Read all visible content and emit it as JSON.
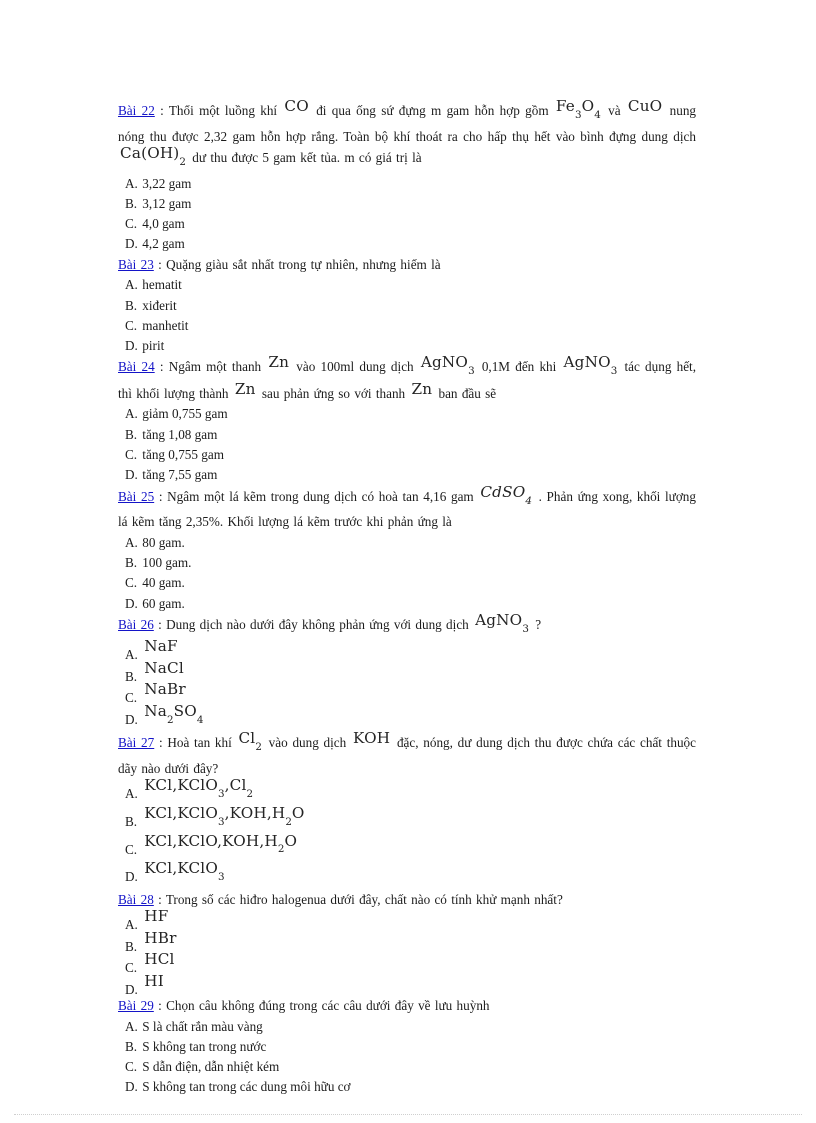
{
  "document": {
    "language": "vi",
    "subject": "Hoa hoc - trac nghiem",
    "accent_color": "#1414c8",
    "text_color": "#1c1c1c"
  },
  "questions": [
    {
      "label": "Bài 22",
      "separator": ":",
      "stem_parts": [
        {
          "type": "text",
          "value": "Thổi một luồng khí "
        },
        {
          "type": "chem",
          "value": "CO"
        },
        {
          "type": "text",
          "value": " đi qua ống sứ đựng m gam hỗn hợp gồm "
        },
        {
          "type": "chem",
          "value": "Fe3O4"
        },
        {
          "type": "text",
          "value": " và "
        },
        {
          "type": "chem",
          "value": "CuO"
        },
        {
          "type": "text",
          "value": " nung nóng thu được 2,32 gam hỗn hợp rắng. Toàn bộ khí thoát ra cho hấp thụ hết vào bình đựng dung dịch "
        },
        {
          "type": "chem",
          "value": "Ca(OH)2"
        },
        {
          "type": "text",
          "value": " dư thu được 5 gam kết tủa. m có giá trị là"
        }
      ],
      "options": [
        {
          "letter": "A.",
          "text": "3,22 gam"
        },
        {
          "letter": "B.",
          "text": "3,12 gam"
        },
        {
          "letter": "C.",
          "text": "4,0 gam"
        },
        {
          "letter": "D.",
          "text": "4,2 gam"
        }
      ]
    },
    {
      "label": "Bài 23",
      "separator": ":",
      "stem_parts": [
        {
          "type": "text",
          "value": "Quặng giàu  sắt nhất trong tự nhiên,  nhưng hiếm  là"
        }
      ],
      "options": [
        {
          "letter": "A.",
          "text": "hematit"
        },
        {
          "letter": "B.",
          "text": "xiđerit"
        },
        {
          "letter": "C.",
          "text": "manhetit"
        },
        {
          "letter": "D.",
          "text": "pirit"
        }
      ]
    },
    {
      "label": "Bài 24",
      "separator": ":",
      "stem_parts": [
        {
          "type": "text",
          "value": "Ngâm một thanh "
        },
        {
          "type": "chem",
          "value": "Zn"
        },
        {
          "type": "text",
          "value": " vào 100ml dung dịch "
        },
        {
          "type": "chem",
          "value": "AgNO3"
        },
        {
          "type": "text",
          "value": " 0,1M đến khi "
        },
        {
          "type": "chem",
          "value": "AgNO3"
        },
        {
          "type": "text",
          "value": " tác dụng hết, thì khối lượng thành "
        },
        {
          "type": "chem",
          "value": "Zn"
        },
        {
          "type": "text",
          "value": " sau phản ứng so với thanh "
        },
        {
          "type": "chem",
          "value": "Zn"
        },
        {
          "type": "text",
          "value": " ban đầu sẽ"
        }
      ],
      "options": [
        {
          "letter": "A.",
          "text": "giảm  0,755 gam"
        },
        {
          "letter": "B.",
          "text": "tăng  1,08 gam"
        },
        {
          "letter": "C.",
          "text": "tăng 0,755 gam"
        },
        {
          "letter": "D.",
          "text": "tăng 7,55 gam"
        }
      ]
    },
    {
      "label": "Bài 25",
      "separator": ":",
      "stem_parts": [
        {
          "type": "text",
          "value": "Ngâm một lá kẽm trong dung dịch có hoà tan 4,16 gam "
        },
        {
          "type": "chem-italic",
          "value": "CdSO4"
        },
        {
          "type": "text",
          "value": " . Phản ứng xong, khối lượng lá kẽm tăng 2,35%. Khối lượng lá kẽm trước khi phản ứng là"
        }
      ],
      "options": [
        {
          "letter": "A.",
          "text": "80 gam."
        },
        {
          "letter": "B.",
          "text": "100 gam."
        },
        {
          "letter": "C.",
          "text": "40 gam."
        },
        {
          "letter": "D.",
          "text": "60 gam."
        }
      ]
    },
    {
      "label": "Bài 26",
      "separator": ":",
      "stem_parts": [
        {
          "type": "text",
          "value": "Dung  dịch  nào  dưới  đây  không  phản  ứng  với  dung  dịch "
        },
        {
          "type": "chem",
          "value": "AgNO3"
        },
        {
          "type": "text",
          "value": " ?"
        }
      ],
      "options": [
        {
          "letter": "A.",
          "chem": "NaF"
        },
        {
          "letter": "B.",
          "chem": "NaCl"
        },
        {
          "letter": "C.",
          "chem": "NaBr"
        },
        {
          "letter": "D.",
          "chem": "Na2SO4"
        }
      ]
    },
    {
      "label": "Bài 27",
      "separator": ":",
      "stem_parts": [
        {
          "type": "text",
          "value": "Hoà tan khí "
        },
        {
          "type": "chem",
          "value": "Cl2"
        },
        {
          "type": "text",
          "value": " vào dung dịch "
        },
        {
          "type": "chem",
          "value": "KOH"
        },
        {
          "type": "text",
          "value": " đặc, nóng,  dư dung dịch thu được chứa các chất thuộc dãy nào dưới đây?"
        }
      ],
      "options": [
        {
          "letter": "A.",
          "chem": "KCl,KClO3,Cl2"
        },
        {
          "letter": "B.",
          "chem": "KCl,KClO3,KOH,H2O"
        },
        {
          "letter": "C.",
          "chem": "KCl,KClO,KOH,H2O"
        },
        {
          "letter": "D.",
          "chem": "KCl,KClO3"
        }
      ]
    },
    {
      "label": "Bài 28",
      "separator": ":",
      "stem_parts": [
        {
          "type": "text",
          "value": "Trong số các hiđro  halogenua  dưới đây, chất nào có tính  khử mạnh nhất?"
        }
      ],
      "options": [
        {
          "letter": "A.",
          "chem": "HF"
        },
        {
          "letter": "B.",
          "chem": "HBr"
        },
        {
          "letter": "C.",
          "chem": "HCl"
        },
        {
          "letter": "D.",
          "chem": "HI"
        }
      ]
    },
    {
      "label": "Bài 29",
      "separator": ":",
      "stem_parts": [
        {
          "type": "text",
          "value": "Chọn câu không  đúng trong các câu dưới đây về lưu huỳnh"
        }
      ],
      "options": [
        {
          "letter": "A.",
          "text": "S là chất rắn màu  vàng"
        },
        {
          "letter": "B.",
          "text": "S không tan trong nước"
        },
        {
          "letter": "C.",
          "text": "S dẫn điện, dẫn nhiệt  kém"
        },
        {
          "letter": "D.",
          "text": "S không tan trong các dung môi hữu cơ"
        }
      ]
    }
  ]
}
